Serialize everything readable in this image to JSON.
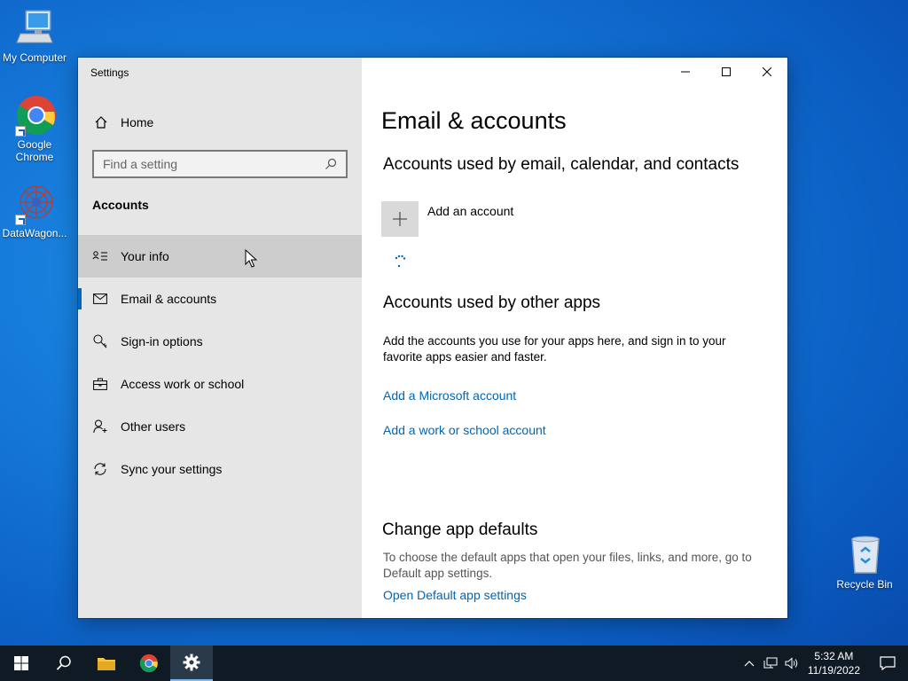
{
  "desktop": {
    "icons": [
      {
        "label": "My Computer"
      },
      {
        "label": "Google Chrome"
      },
      {
        "label": "DataWagon..."
      },
      {
        "label": "Recycle Bin"
      }
    ]
  },
  "window": {
    "title": "Settings",
    "sidebar": {
      "home_label": "Home",
      "search_placeholder": "Find a setting",
      "section": "Accounts",
      "items": [
        {
          "label": "Your info",
          "icon": "contact-card-icon"
        },
        {
          "label": "Email & accounts",
          "icon": "mail-icon"
        },
        {
          "label": "Sign-in options",
          "icon": "key-icon"
        },
        {
          "label": "Access work or school",
          "icon": "briefcase-icon"
        },
        {
          "label": "Other users",
          "icon": "add-person-icon"
        },
        {
          "label": "Sync your settings",
          "icon": "sync-icon"
        }
      ]
    },
    "content": {
      "title": "Email & accounts",
      "section1_title": "Accounts used by email, calendar, and contacts",
      "add_account_label": "Add an account",
      "section2_title": "Accounts used by other apps",
      "section2_desc": "Add the accounts you use for your apps here, and sign in to your favorite apps easier and faster.",
      "link_microsoft": "Add a Microsoft account",
      "link_work": "Add a work or school account",
      "section3_title": "Change app defaults",
      "section3_desc": "To choose the default apps that open your files, links, and more, go to Default app settings.",
      "link_defaults": "Open Default app settings"
    }
  },
  "taskbar": {
    "time": "5:32 AM",
    "date": "11/19/2022"
  },
  "colors": {
    "accent": "#0067c0",
    "link": "#0066b4",
    "sidebar_bg": "#e6e6e6",
    "taskbar_bg": "#0f1a24"
  }
}
